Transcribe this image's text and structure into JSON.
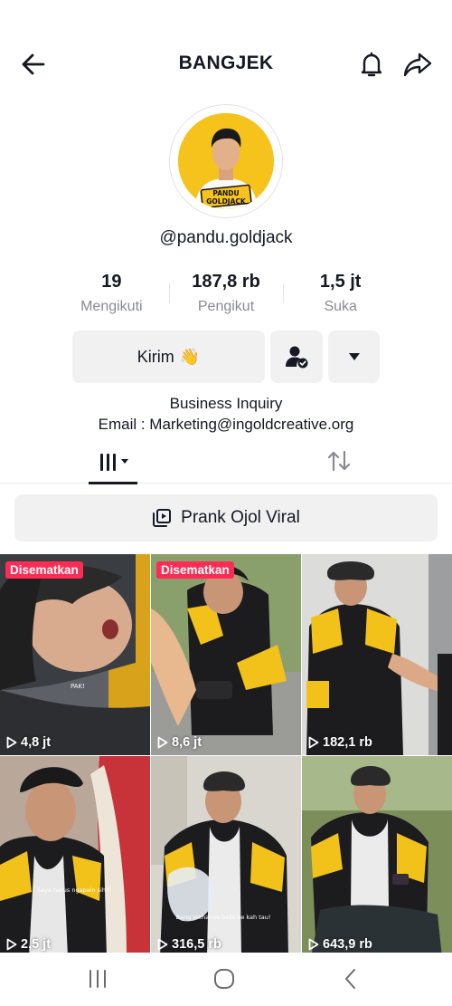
{
  "header": {
    "title": "BANGJEK",
    "back_icon": "arrow-left-icon",
    "bell_icon": "bell-icon",
    "share_icon": "share-arrow-icon"
  },
  "profile": {
    "handle": "@pandu.goldjack",
    "avatar_badge": "PANDU GOLDJACK"
  },
  "stats": [
    {
      "value": "19",
      "label": "Mengikuti"
    },
    {
      "value": "187,8 rb",
      "label": "Pengikut"
    },
    {
      "value": "1,5 jt",
      "label": "Suka"
    }
  ],
  "actions": {
    "message_label": "Kirim",
    "message_emoji": "👋",
    "follow_icon": "person-check-icon",
    "more_icon": "caret-down-icon"
  },
  "bio": {
    "line1": "Business Inquiry",
    "line2": "Email : Marketing@ingoldcreative.org"
  },
  "tabs": {
    "videos_icon": "grid-bars-icon",
    "repost_icon": "repost-icon"
  },
  "playlist": {
    "label": "Prank Ojol Viral",
    "icon": "playlist-icon"
  },
  "videos": [
    {
      "views": "4,8 jt",
      "pinned": "Disematkan",
      "caption": "PAK!"
    },
    {
      "views": "8,6 jt",
      "pinned": "Disematkan",
      "caption": ""
    },
    {
      "views": "182,1 rb",
      "pinned": "",
      "caption": ""
    },
    {
      "views": "2,5 jt",
      "pinned": "",
      "caption": "Saya harus ngapain sih?!"
    },
    {
      "views": "316,5 rb",
      "pinned": "",
      "caption": "Bang Jekhar-us balik ke kah tau!"
    },
    {
      "views": "643,9 rb",
      "pinned": "",
      "caption": ""
    }
  ],
  "colors": {
    "accent": "#fe2c55",
    "jacket_yellow": "#f2c21b",
    "jacket_black": "#1c1c1e"
  },
  "system_nav": {
    "recent_icon": "recent-apps-icon",
    "home_icon": "home-circle-icon",
    "back_icon": "chevron-left-icon"
  }
}
